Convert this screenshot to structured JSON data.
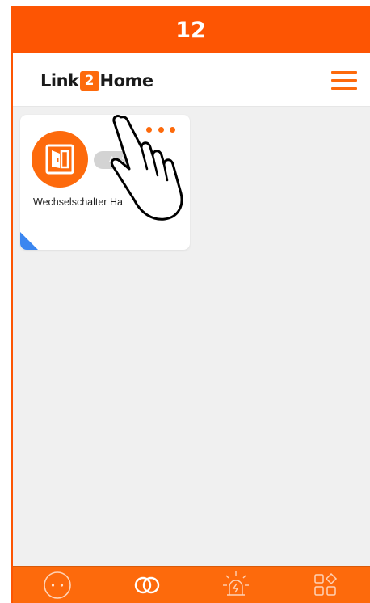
{
  "step": {
    "number": "12"
  },
  "header": {
    "logo": {
      "part1": "Link",
      "badge": "2",
      "part2": "Home"
    },
    "menu_icon": "hamburger-menu-icon"
  },
  "device_card": {
    "name": "Wechselschalter Ha",
    "status": "AUS",
    "icon": "switch-device-icon",
    "more_icon": "more-dots-icon"
  },
  "tabbar": {
    "tabs": [
      {
        "icon": "smiley-face-icon",
        "active": false
      },
      {
        "icon": "link-rings-icon",
        "active": true
      },
      {
        "icon": "alarm-siren-icon",
        "active": false
      },
      {
        "icon": "grid-apps-icon",
        "active": false
      }
    ]
  },
  "colors": {
    "accent": "#fd5503",
    "brand_orange": "#fd6a0c",
    "background": "#f0f0f0",
    "pill": "#d3d3d3",
    "corner_badge": "#3b86f0"
  }
}
